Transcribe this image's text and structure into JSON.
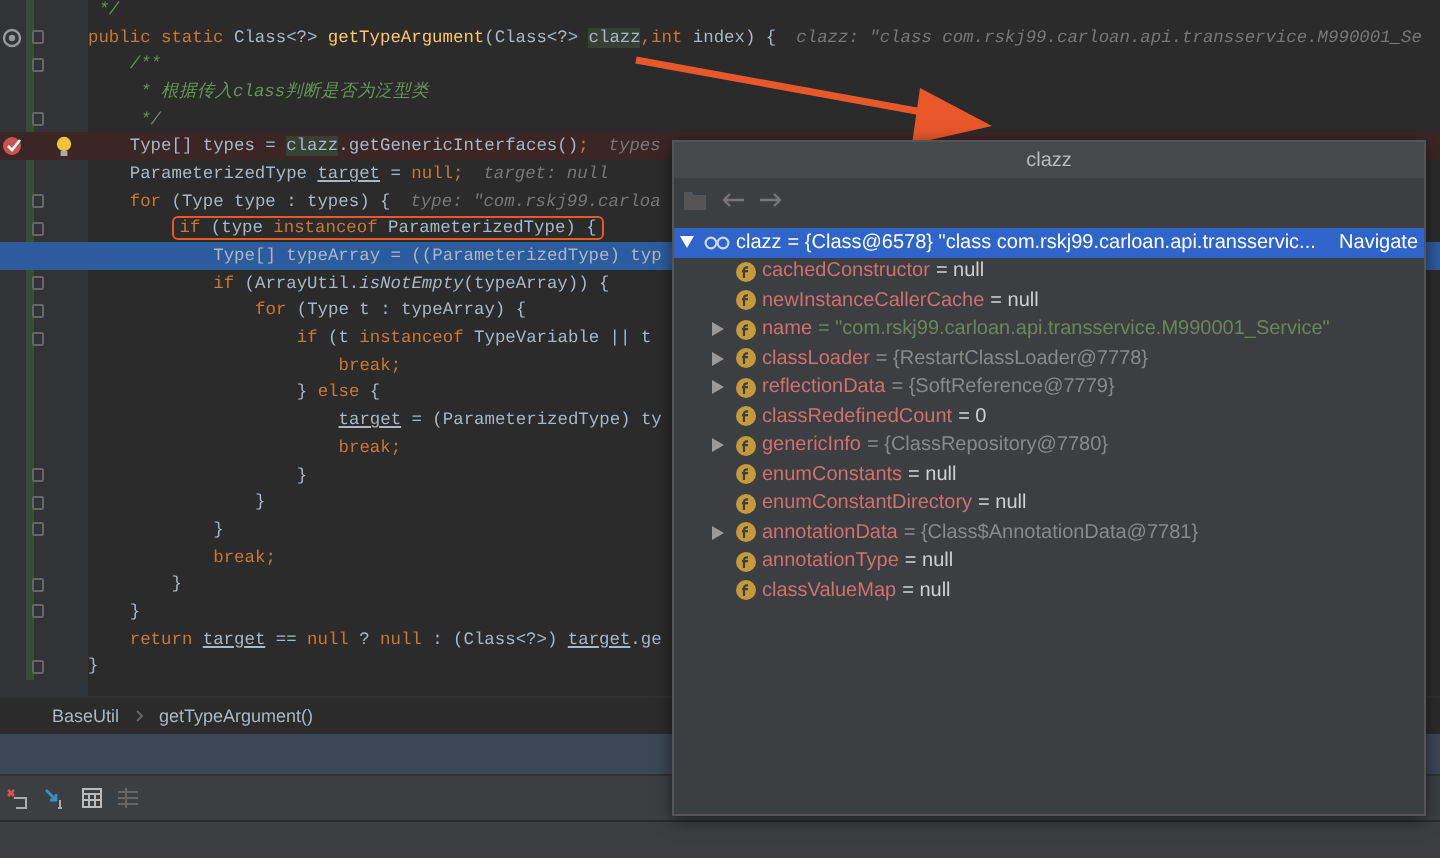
{
  "editor": {
    "lines": [
      {
        "kind": "doc",
        "fold": false,
        "current": false,
        "boxed": false,
        "tokens": [
          {
            "kind": "doc",
            "text": "*/"
          }
        ]
      },
      {
        "kind": "override",
        "fold": true,
        "current": false,
        "boxed": false,
        "tokens": [
          {
            "kind": "kw",
            "text": "public static "
          },
          {
            "kind": "plain",
            "text": "Class<?> "
          },
          {
            "kind": "fn",
            "text": "getTypeArgument"
          },
          {
            "kind": "plain",
            "text": "(Class<?> "
          },
          {
            "kind": "usage",
            "text": "clazz"
          },
          {
            "kind": "kw",
            "text": ",int "
          },
          {
            "kind": "plain",
            "text": "index) {"
          },
          {
            "kind": "hint",
            "text": "clazz: \"class com.rskj99.carloan.api.transservice.M990001_Se"
          }
        ],
        "children": [
          {
            "kind": "code",
            "fold": true,
            "current": false,
            "boxed": false,
            "tokens": [
              {
                "kind": "doc",
                "text": "/**"
              }
            ]
          },
          {
            "kind": "doc",
            "fold": false,
            "current": false,
            "boxed": false,
            "tokens": [
              {
                "kind": "doc",
                "text": "* 根据传入class判断是否为泛型类"
              }
            ]
          },
          {
            "kind": "doc",
            "fold": true,
            "current": false,
            "boxed": false,
            "tokens": [
              {
                "kind": "doc",
                "text": "*/"
              }
            ]
          },
          {
            "kind": "breakpoint",
            "fold": false,
            "current": false,
            "boxed": false,
            "tokens": [
              {
                "kind": "plain",
                "text": "Type[] types = "
              },
              {
                "kind": "usage",
                "text": "clazz"
              },
              {
                "kind": "plain",
                "text": ".getGenericInterfaces()"
              },
              {
                "kind": "kw",
                "text": ";"
              },
              {
                "kind": "hint",
                "text": "types"
              }
            ]
          },
          {
            "kind": "code",
            "fold": false,
            "current": false,
            "boxed": false,
            "tokens": [
              {
                "kind": "plain",
                "text": "ParameterizedType "
              },
              {
                "kind": "under",
                "text": "target"
              },
              {
                "kind": "plain",
                "text": " = "
              },
              {
                "kind": "kw",
                "text": "null;"
              },
              {
                "kind": "hint",
                "text": "target: null"
              }
            ]
          },
          {
            "kind": "code",
            "fold": true,
            "current": false,
            "boxed": false,
            "tokens": [
              {
                "kind": "kw",
                "text": "for "
              },
              {
                "kind": "plain",
                "text": "(Type type : types) {"
              },
              {
                "kind": "hint",
                "text": "type: \"com.rskj99.carloa"
              }
            ],
            "children": [
              {
                "kind": "code",
                "fold": true,
                "current": false,
                "boxed": true,
                "tokens": [
                  {
                    "kind": "kw",
                    "text": "if "
                  },
                  {
                    "kind": "plain",
                    "text": "(type "
                  },
                  {
                    "kind": "kw",
                    "text": "instanceof "
                  },
                  {
                    "kind": "plain",
                    "text": "ParameterizedType) {"
                  }
                ],
                "children": [
                  {
                    "kind": "code",
                    "fold": false,
                    "current": true,
                    "boxed": false,
                    "tokens": [
                      {
                        "kind": "plain",
                        "text": "Type[] typeArray = ((ParameterizedType) typ"
                      }
                    ]
                  },
                  {
                    "kind": "code",
                    "fold": true,
                    "current": false,
                    "boxed": false,
                    "tokens": [
                      {
                        "kind": "kw",
                        "text": "if "
                      },
                      {
                        "kind": "plain",
                        "text": "(ArrayUtil."
                      },
                      {
                        "kind": "static",
                        "text": "isNotEmpty"
                      },
                      {
                        "kind": "plain",
                        "text": "(typeArray)) {"
                      }
                    ],
                    "children": [
                      {
                        "kind": "code",
                        "fold": true,
                        "current": false,
                        "boxed": false,
                        "tokens": [
                          {
                            "kind": "kw",
                            "text": "for "
                          },
                          {
                            "kind": "plain",
                            "text": "(Type t : typeArray) {"
                          }
                        ],
                        "children": [
                          {
                            "kind": "code",
                            "fold": true,
                            "current": false,
                            "boxed": false,
                            "tokens": [
                              {
                                "kind": "kw",
                                "text": "if "
                              },
                              {
                                "kind": "plain",
                                "text": "(t "
                              },
                              {
                                "kind": "kw",
                                "text": "instanceof "
                              },
                              {
                                "kind": "plain",
                                "text": "TypeVariable || t"
                              }
                            ],
                            "children": [
                              {
                                "kind": "code",
                                "fold": false,
                                "current": false,
                                "boxed": false,
                                "tokens": [
                                  {
                                    "kind": "kw",
                                    "text": "break;"
                                  }
                                ]
                              }
                            ]
                          },
                          {
                            "kind": "code",
                            "fold": false,
                            "current": false,
                            "boxed": false,
                            "tokens": [
                              {
                                "kind": "plain",
                                "text": "} "
                              },
                              {
                                "kind": "kw",
                                "text": "else "
                              },
                              {
                                "kind": "plain",
                                "text": "{"
                              }
                            ],
                            "children": [
                              {
                                "kind": "code",
                                "fold": false,
                                "current": false,
                                "boxed": false,
                                "tokens": [
                                  {
                                    "kind": "under",
                                    "text": "target"
                                  },
                                  {
                                    "kind": "plain",
                                    "text": " = (ParameterizedType) ty"
                                  }
                                ]
                              },
                              {
                                "kind": "code",
                                "fold": false,
                                "current": false,
                                "boxed": false,
                                "tokens": [
                                  {
                                    "kind": "kw",
                                    "text": "break;"
                                  }
                                ]
                              }
                            ]
                          },
                          {
                            "kind": "code",
                            "fold": true,
                            "current": false,
                            "boxed": false,
                            "tokens": [
                              {
                                "kind": "plain",
                                "text": "}"
                              }
                            ]
                          }
                        ]
                      },
                      {
                        "kind": "code",
                        "fold": true,
                        "current": false,
                        "boxed": false,
                        "tokens": [
                          {
                            "kind": "plain",
                            "text": "}"
                          }
                        ]
                      }
                    ]
                  },
                  {
                    "kind": "code",
                    "fold": true,
                    "current": false,
                    "boxed": false,
                    "tokens": [
                      {
                        "kind": "plain",
                        "text": "}"
                      }
                    ]
                  },
                  {
                    "kind": "code",
                    "fold": false,
                    "current": false,
                    "boxed": false,
                    "tokens": [
                      {
                        "kind": "kw",
                        "text": "break;"
                      }
                    ]
                  }
                ]
              },
              {
                "kind": "code",
                "fold": true,
                "current": false,
                "boxed": false,
                "tokens": [
                  {
                    "kind": "plain",
                    "text": "}"
                  }
                ]
              }
            ]
          },
          {
            "kind": "code",
            "fold": true,
            "current": false,
            "boxed": false,
            "tokens": [
              {
                "kind": "plain",
                "text": "}"
              }
            ]
          },
          {
            "kind": "code",
            "fold": false,
            "current": false,
            "boxed": false,
            "tokens": [
              {
                "kind": "kw",
                "text": "return "
              },
              {
                "kind": "under",
                "text": "target"
              },
              {
                "kind": "plain",
                "text": " == "
              },
              {
                "kind": "kw",
                "text": "null "
              },
              {
                "kind": "plain",
                "text": "? "
              },
              {
                "kind": "kw",
                "text": "null "
              },
              {
                "kind": "plain",
                "text": ": (Class<?>) "
              },
              {
                "kind": "under",
                "text": "target"
              },
              {
                "kind": "plain",
                "text": ".ge"
              }
            ]
          }
        ]
      },
      {
        "kind": "code",
        "fold": true,
        "current": false,
        "boxed": false,
        "tokens": [
          {
            "kind": "plain",
            "text": "}"
          }
        ]
      }
    ]
  },
  "breadcrumb": [
    "BaseUtil",
    "getTypeArgument()"
  ],
  "popup": {
    "title": "clazz",
    "root": {
      "name": "clazz",
      "value": "= {Class@6578} \"class com.rskj99.carloan.api.transservic...",
      "link": "Navigate",
      "expanded": true,
      "selected": true,
      "children": [
        {
          "name": "cachedConstructor",
          "value": "= null",
          "kind": "null",
          "expandable": false,
          "selected": false
        },
        {
          "name": "newInstanceCallerCache",
          "value": "= null",
          "kind": "null",
          "expandable": false,
          "selected": false
        },
        {
          "name": "name",
          "value": "= \"com.rskj99.carloan.api.transservice.M990001_Service\"",
          "kind": "string",
          "expandable": true,
          "selected": false
        },
        {
          "name": "classLoader",
          "value": "= {RestartClassLoader@7778}",
          "kind": "ref",
          "expandable": true,
          "selected": false
        },
        {
          "name": "reflectionData",
          "value": "= {SoftReference@7779}",
          "kind": "ref",
          "expandable": true,
          "selected": false
        },
        {
          "name": "classRedefinedCount",
          "value": "= 0",
          "kind": "number",
          "expandable": false,
          "selected": false
        },
        {
          "name": "genericInfo",
          "value": "= {ClassRepository@7780}",
          "kind": "ref",
          "expandable": true,
          "selected": false
        },
        {
          "name": "enumConstants",
          "value": "= null",
          "kind": "null",
          "expandable": false,
          "selected": false
        },
        {
          "name": "enumConstantDirectory",
          "value": "= null",
          "kind": "null",
          "expandable": false,
          "selected": false
        },
        {
          "name": "annotationData",
          "value": "= {Class$AnnotationData@7781}",
          "kind": "ref",
          "expandable": true,
          "selected": false
        },
        {
          "name": "annotationType",
          "value": "= null",
          "kind": "null",
          "expandable": false,
          "selected": false
        },
        {
          "name": "classValueMap",
          "value": "= null",
          "kind": "null",
          "expandable": false,
          "selected": false
        }
      ]
    }
  }
}
